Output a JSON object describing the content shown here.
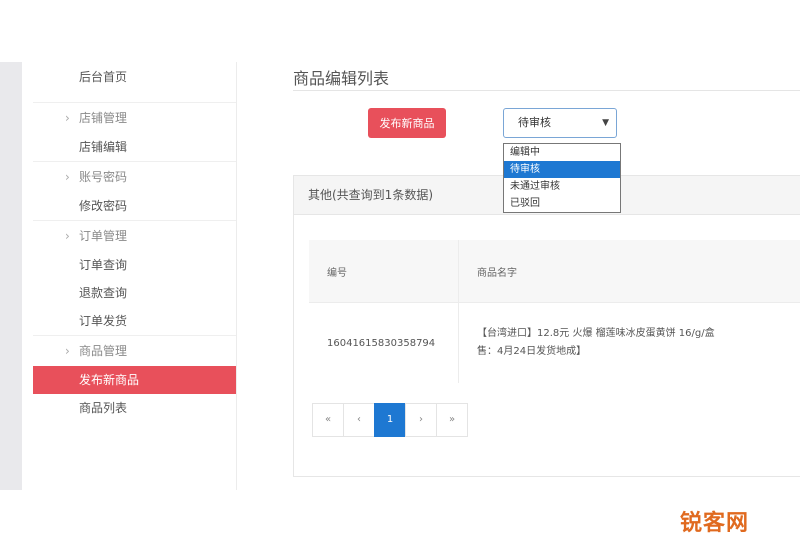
{
  "sidebar": {
    "groups": [
      {
        "title": "",
        "items": [
          {
            "label": "后台首页"
          }
        ]
      },
      {
        "title": "店铺管理",
        "items": [
          {
            "label": "店铺编辑"
          }
        ]
      },
      {
        "title": "账号密码",
        "items": [
          {
            "label": "修改密码"
          }
        ]
      },
      {
        "title": "订单管理",
        "items": [
          {
            "label": "订单查询"
          },
          {
            "label": "退款查询"
          },
          {
            "label": "订单发货"
          }
        ]
      },
      {
        "title": "商品管理",
        "items": [
          {
            "label": "发布新商品",
            "active": true
          },
          {
            "label": "商品列表"
          }
        ]
      }
    ]
  },
  "main": {
    "page_title": "商品编辑列表",
    "new_button_label": "发布新商品",
    "status_select": {
      "selected": "待审核",
      "options": [
        "编辑中",
        "待审核",
        "未通过审核",
        "已驳回"
      ],
      "highlighted_index": 1
    },
    "panel_title": "其他(共查询到1条数据)",
    "table": {
      "headers": [
        "编号",
        "商品名字"
      ],
      "rows": [
        {
          "id": "16041615830358794",
          "name_line1": "【台湾进口】12.8元 火爆 榴莲味冰皮蛋黄饼 16/g/盒",
          "name_line2": "售：4月24日发货地成】"
        }
      ]
    },
    "pagination": [
      "«",
      "‹",
      "1",
      "›",
      "»"
    ],
    "current_page": "1"
  },
  "watermark": "锐客网",
  "colors": {
    "accent_red": "#e8505b",
    "accent_blue": "#1e78d2",
    "watermark": "#e06a1f"
  }
}
